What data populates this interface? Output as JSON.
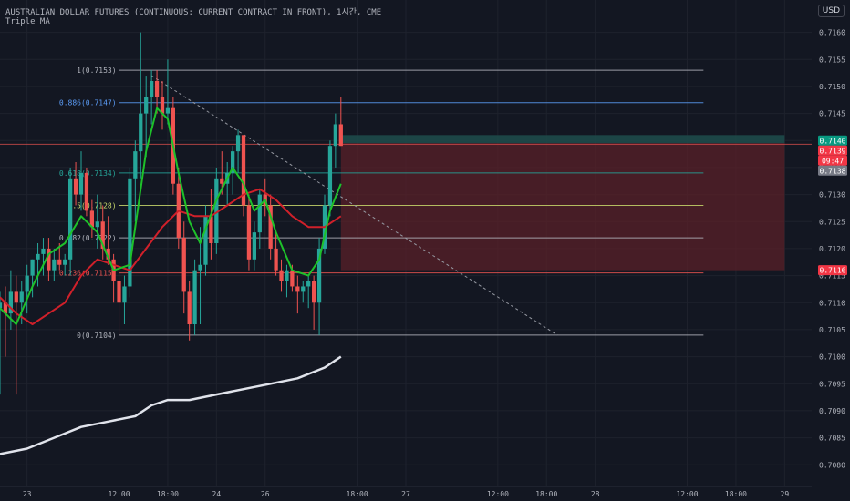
{
  "header": {
    "symbol": "AUSTRALIAN DOLLAR FUTURES (CONTINUOUS: CURRENT CONTRACT IN FRONT), 1시간, CME",
    "indicator": "Triple MA",
    "currency": "USD"
  },
  "colors": {
    "background": "#131722",
    "grid": "#1e222d",
    "up": "#26a69a",
    "down": "#ef5350",
    "ma_fast": "#1ec12a",
    "ma_mid": "#d0202a",
    "ma_slow": "#e0e3eb",
    "fib_line": "#787b86",
    "stop_zone": "#5a2028",
    "target_zone": "#1e4a4a"
  },
  "chart_data": {
    "type": "candlestick",
    "y_range": [
      0.7076,
      0.7166
    ],
    "x_range": [
      0,
      150
    ],
    "price_ticks": [
      "0.7160",
      "0.7155",
      "0.7150",
      "0.7145",
      "0.7140",
      "0.7135",
      "0.7130",
      "0.7125",
      "0.7120",
      "0.7115",
      "0.7110",
      "0.7105",
      "0.7100",
      "0.7095",
      "0.7090",
      "0.7085",
      "0.7080"
    ],
    "time_labels": [
      {
        "x": 5,
        "label": "23"
      },
      {
        "x": 22,
        "label": "12:00"
      },
      {
        "x": 31,
        "label": "18:00"
      },
      {
        "x": 40,
        "label": "24"
      },
      {
        "x": 49,
        "label": "26"
      },
      {
        "x": 66,
        "label": "18:00"
      },
      {
        "x": 75,
        "label": "27"
      },
      {
        "x": 92,
        "label": "12:00"
      },
      {
        "x": 101,
        "label": "18:00"
      },
      {
        "x": 110,
        "label": "28"
      },
      {
        "x": 127,
        "label": "12:00"
      },
      {
        "x": 136,
        "label": "18:00"
      },
      {
        "x": 145,
        "label": "29"
      }
    ],
    "candles": [
      {
        "x": 0,
        "o": 0.7109,
        "h": 0.7112,
        "l": 0.7093,
        "c": 0.711
      },
      {
        "x": 1,
        "o": 0.711,
        "h": 0.7113,
        "l": 0.71,
        "c": 0.7108
      },
      {
        "x": 2,
        "o": 0.7108,
        "h": 0.7116,
        "l": 0.7105,
        "c": 0.7112
      },
      {
        "x": 3,
        "o": 0.7112,
        "h": 0.7115,
        "l": 0.7093,
        "c": 0.711
      },
      {
        "x": 4,
        "o": 0.711,
        "h": 0.7114,
        "l": 0.7106,
        "c": 0.7112
      },
      {
        "x": 5,
        "o": 0.7112,
        "h": 0.7117,
        "l": 0.7108,
        "c": 0.7115
      },
      {
        "x": 6,
        "o": 0.7115,
        "h": 0.7118,
        "l": 0.7111,
        "c": 0.7118
      },
      {
        "x": 7,
        "o": 0.7118,
        "h": 0.7121,
        "l": 0.7113,
        "c": 0.7119
      },
      {
        "x": 8,
        "o": 0.7119,
        "h": 0.7122,
        "l": 0.7115,
        "c": 0.712
      },
      {
        "x": 9,
        "o": 0.712,
        "h": 0.7122,
        "l": 0.7114,
        "c": 0.7116
      },
      {
        "x": 10,
        "o": 0.7116,
        "h": 0.712,
        "l": 0.7114,
        "c": 0.7118
      },
      {
        "x": 11,
        "o": 0.7118,
        "h": 0.7121,
        "l": 0.7116,
        "c": 0.7117
      },
      {
        "x": 12,
        "o": 0.7117,
        "h": 0.7119,
        "l": 0.7115,
        "c": 0.7118
      },
      {
        "x": 13,
        "o": 0.7118,
        "h": 0.7135,
        "l": 0.7115,
        "c": 0.7133
      },
      {
        "x": 14,
        "o": 0.7133,
        "h": 0.7136,
        "l": 0.7128,
        "c": 0.713
      },
      {
        "x": 15,
        "o": 0.713,
        "h": 0.7138,
        "l": 0.7127,
        "c": 0.7134
      },
      {
        "x": 16,
        "o": 0.7134,
        "h": 0.7135,
        "l": 0.7126,
        "c": 0.7127
      },
      {
        "x": 17,
        "o": 0.7127,
        "h": 0.7129,
        "l": 0.7122,
        "c": 0.7124
      },
      {
        "x": 18,
        "o": 0.7124,
        "h": 0.713,
        "l": 0.712,
        "c": 0.7125
      },
      {
        "x": 19,
        "o": 0.7125,
        "h": 0.7128,
        "l": 0.7118,
        "c": 0.712
      },
      {
        "x": 20,
        "o": 0.712,
        "h": 0.7126,
        "l": 0.7117,
        "c": 0.7118
      },
      {
        "x": 21,
        "o": 0.7118,
        "h": 0.7119,
        "l": 0.711,
        "c": 0.7114
      },
      {
        "x": 22,
        "o": 0.7114,
        "h": 0.7117,
        "l": 0.7104,
        "c": 0.711
      },
      {
        "x": 23,
        "o": 0.711,
        "h": 0.7115,
        "l": 0.7106,
        "c": 0.7113
      },
      {
        "x": 24,
        "o": 0.7113,
        "h": 0.7135,
        "l": 0.7111,
        "c": 0.7133
      },
      {
        "x": 25,
        "o": 0.7133,
        "h": 0.714,
        "l": 0.7125,
        "c": 0.7138
      },
      {
        "x": 26,
        "o": 0.7138,
        "h": 0.716,
        "l": 0.7133,
        "c": 0.7145
      },
      {
        "x": 27,
        "o": 0.7145,
        "h": 0.7152,
        "l": 0.7137,
        "c": 0.7148
      },
      {
        "x": 28,
        "o": 0.7148,
        "h": 0.7153,
        "l": 0.7143,
        "c": 0.7151
      },
      {
        "x": 29,
        "o": 0.7151,
        "h": 0.7153,
        "l": 0.7145,
        "c": 0.7148
      },
      {
        "x": 30,
        "o": 0.7148,
        "h": 0.7151,
        "l": 0.7142,
        "c": 0.7145
      },
      {
        "x": 31,
        "o": 0.7145,
        "h": 0.7155,
        "l": 0.7143,
        "c": 0.7146
      },
      {
        "x": 32,
        "o": 0.7146,
        "h": 0.7148,
        "l": 0.713,
        "c": 0.7132
      },
      {
        "x": 33,
        "o": 0.7132,
        "h": 0.7135,
        "l": 0.712,
        "c": 0.7122
      },
      {
        "x": 34,
        "o": 0.7122,
        "h": 0.7125,
        "l": 0.7108,
        "c": 0.7112
      },
      {
        "x": 35,
        "o": 0.7112,
        "h": 0.7114,
        "l": 0.7103,
        "c": 0.7106
      },
      {
        "x": 36,
        "o": 0.7106,
        "h": 0.7118,
        "l": 0.7104,
        "c": 0.7116
      },
      {
        "x": 37,
        "o": 0.7116,
        "h": 0.7124,
        "l": 0.7106,
        "c": 0.7117
      },
      {
        "x": 38,
        "o": 0.7117,
        "h": 0.7128,
        "l": 0.7115,
        "c": 0.7126
      },
      {
        "x": 39,
        "o": 0.7126,
        "h": 0.7131,
        "l": 0.7118,
        "c": 0.7121
      },
      {
        "x": 40,
        "o": 0.7121,
        "h": 0.7135,
        "l": 0.7119,
        "c": 0.7133
      },
      {
        "x": 41,
        "o": 0.7133,
        "h": 0.7138,
        "l": 0.713,
        "c": 0.7132
      },
      {
        "x": 42,
        "o": 0.7132,
        "h": 0.7136,
        "l": 0.7128,
        "c": 0.7134
      },
      {
        "x": 43,
        "o": 0.7134,
        "h": 0.7139,
        "l": 0.713,
        "c": 0.7138
      },
      {
        "x": 44,
        "o": 0.7138,
        "h": 0.7142,
        "l": 0.7134,
        "c": 0.7141
      },
      {
        "x": 45,
        "o": 0.7141,
        "h": 0.7141,
        "l": 0.7126,
        "c": 0.7128
      },
      {
        "x": 46,
        "o": 0.7128,
        "h": 0.713,
        "l": 0.7116,
        "c": 0.7118
      },
      {
        "x": 47,
        "o": 0.7118,
        "h": 0.7125,
        "l": 0.7116,
        "c": 0.7123
      },
      {
        "x": 48,
        "o": 0.7123,
        "h": 0.7131,
        "l": 0.712,
        "c": 0.713
      },
      {
        "x": 49,
        "o": 0.713,
        "h": 0.7133,
        "l": 0.7126,
        "c": 0.7128
      },
      {
        "x": 50,
        "o": 0.7128,
        "h": 0.713,
        "l": 0.7118,
        "c": 0.712
      },
      {
        "x": 51,
        "o": 0.712,
        "h": 0.7123,
        "l": 0.7115,
        "c": 0.7116
      },
      {
        "x": 52,
        "o": 0.7116,
        "h": 0.7118,
        "l": 0.7112,
        "c": 0.7114
      },
      {
        "x": 53,
        "o": 0.7114,
        "h": 0.7117,
        "l": 0.7111,
        "c": 0.7116
      },
      {
        "x": 54,
        "o": 0.7116,
        "h": 0.7117,
        "l": 0.7112,
        "c": 0.7113
      },
      {
        "x": 55,
        "o": 0.7113,
        "h": 0.7115,
        "l": 0.7108,
        "c": 0.7112
      },
      {
        "x": 56,
        "o": 0.7112,
        "h": 0.7114,
        "l": 0.711,
        "c": 0.7113
      },
      {
        "x": 57,
        "o": 0.7113,
        "h": 0.7115,
        "l": 0.7109,
        "c": 0.7114
      },
      {
        "x": 58,
        "o": 0.7114,
        "h": 0.7115,
        "l": 0.7105,
        "c": 0.711
      },
      {
        "x": 59,
        "o": 0.711,
        "h": 0.7122,
        "l": 0.7104,
        "c": 0.712
      },
      {
        "x": 60,
        "o": 0.712,
        "h": 0.713,
        "l": 0.7119,
        "c": 0.7128
      },
      {
        "x": 61,
        "o": 0.7128,
        "h": 0.714,
        "l": 0.7126,
        "c": 0.7139
      },
      {
        "x": 62,
        "o": 0.7139,
        "h": 0.7145,
        "l": 0.7135,
        "c": 0.7143
      },
      {
        "x": 63,
        "o": 0.7143,
        "h": 0.7148,
        "l": 0.7139,
        "c": 0.7139
      }
    ],
    "ma_fast": [
      [
        0,
        0.7109
      ],
      [
        3,
        0.7106
      ],
      [
        6,
        0.7113
      ],
      [
        9,
        0.7119
      ],
      [
        12,
        0.7121
      ],
      [
        15,
        0.7126
      ],
      [
        18,
        0.7123
      ],
      [
        21,
        0.7116
      ],
      [
        24,
        0.7117
      ],
      [
        27,
        0.7138
      ],
      [
        29,
        0.7146
      ],
      [
        31,
        0.7144
      ],
      [
        33,
        0.7134
      ],
      [
        35,
        0.7125
      ],
      [
        37,
        0.7121
      ],
      [
        40,
        0.7129
      ],
      [
        43,
        0.7135
      ],
      [
        45,
        0.7132
      ],
      [
        47,
        0.7127
      ],
      [
        49,
        0.7129
      ],
      [
        51,
        0.7123
      ],
      [
        54,
        0.7116
      ],
      [
        57,
        0.7115
      ],
      [
        59,
        0.7118
      ],
      [
        61,
        0.7127
      ],
      [
        63,
        0.7132
      ]
    ],
    "ma_mid": [
      [
        0,
        0.7111
      ],
      [
        3,
        0.7108
      ],
      [
        6,
        0.7106
      ],
      [
        9,
        0.7108
      ],
      [
        12,
        0.711
      ],
      [
        15,
        0.7115
      ],
      [
        18,
        0.7118
      ],
      [
        21,
        0.7117
      ],
      [
        24,
        0.7116
      ],
      [
        27,
        0.712
      ],
      [
        30,
        0.7124
      ],
      [
        33,
        0.7127
      ],
      [
        36,
        0.7126
      ],
      [
        39,
        0.7126
      ],
      [
        42,
        0.7128
      ],
      [
        45,
        0.713
      ],
      [
        48,
        0.7131
      ],
      [
        51,
        0.7129
      ],
      [
        54,
        0.7126
      ],
      [
        57,
        0.7124
      ],
      [
        60,
        0.7124
      ],
      [
        63,
        0.7126
      ]
    ],
    "ma_slow": [
      [
        0,
        0.7082
      ],
      [
        5,
        0.7083
      ],
      [
        10,
        0.7085
      ],
      [
        15,
        0.7087
      ],
      [
        20,
        0.7088
      ],
      [
        25,
        0.7089
      ],
      [
        28,
        0.7091
      ],
      [
        31,
        0.7092
      ],
      [
        35,
        0.7092
      ],
      [
        40,
        0.7093
      ],
      [
        45,
        0.7094
      ],
      [
        50,
        0.7095
      ],
      [
        55,
        0.7096
      ],
      [
        60,
        0.7098
      ],
      [
        63,
        0.71
      ]
    ],
    "fibonacci": {
      "start_x": 22,
      "end_x": 130,
      "levels": [
        {
          "ratio": "1",
          "price": 0.7153,
          "label": "1(0.7153)",
          "color": "#b2b5be"
        },
        {
          "ratio": "0.886",
          "price": 0.7147,
          "label": "0.886(0.7147)",
          "color": "#5b9cf6"
        },
        {
          "ratio": "0.618",
          "price": 0.7134,
          "label": "0.618(0.7134)",
          "color": "#26a69a"
        },
        {
          "ratio": "0.5",
          "price": 0.7128,
          "label": "0.5(0.7128)",
          "color": "#c8d86b"
        },
        {
          "ratio": "0.382",
          "price": 0.7122,
          "label": "0.382(0.7122)",
          "color": "#b2b5be"
        },
        {
          "ratio": "0.236",
          "price": 0.71155,
          "label": "0.236(0.7115)",
          "color": "#ef5350"
        },
        {
          "ratio": "0",
          "price": 0.7104,
          "label": "0(0.7104)",
          "color": "#b2b5be"
        }
      ]
    },
    "trendline": {
      "x1": 28,
      "y1": 0.7152,
      "x2": 103,
      "y2": 0.7104
    },
    "position": {
      "start_x": 63,
      "end_x": 145,
      "entry": 0.71395,
      "target": 0.7141,
      "stop": 0.7116
    },
    "horizontal_line": {
      "price": 0.71393
    },
    "price_badges": [
      {
        "price": 0.714,
        "label": "0.7140",
        "color": "#089981"
      },
      {
        "price": 0.7139,
        "label": "0.7139",
        "color": "#f23645"
      },
      {
        "price": 0.71363,
        "label": "09:47",
        "color": "#f23645"
      },
      {
        "price": 0.7138,
        "label": "0.7138",
        "color": "#787b86"
      },
      {
        "price": 0.7116,
        "label": "0.7116",
        "color": "#f23645"
      }
    ]
  }
}
